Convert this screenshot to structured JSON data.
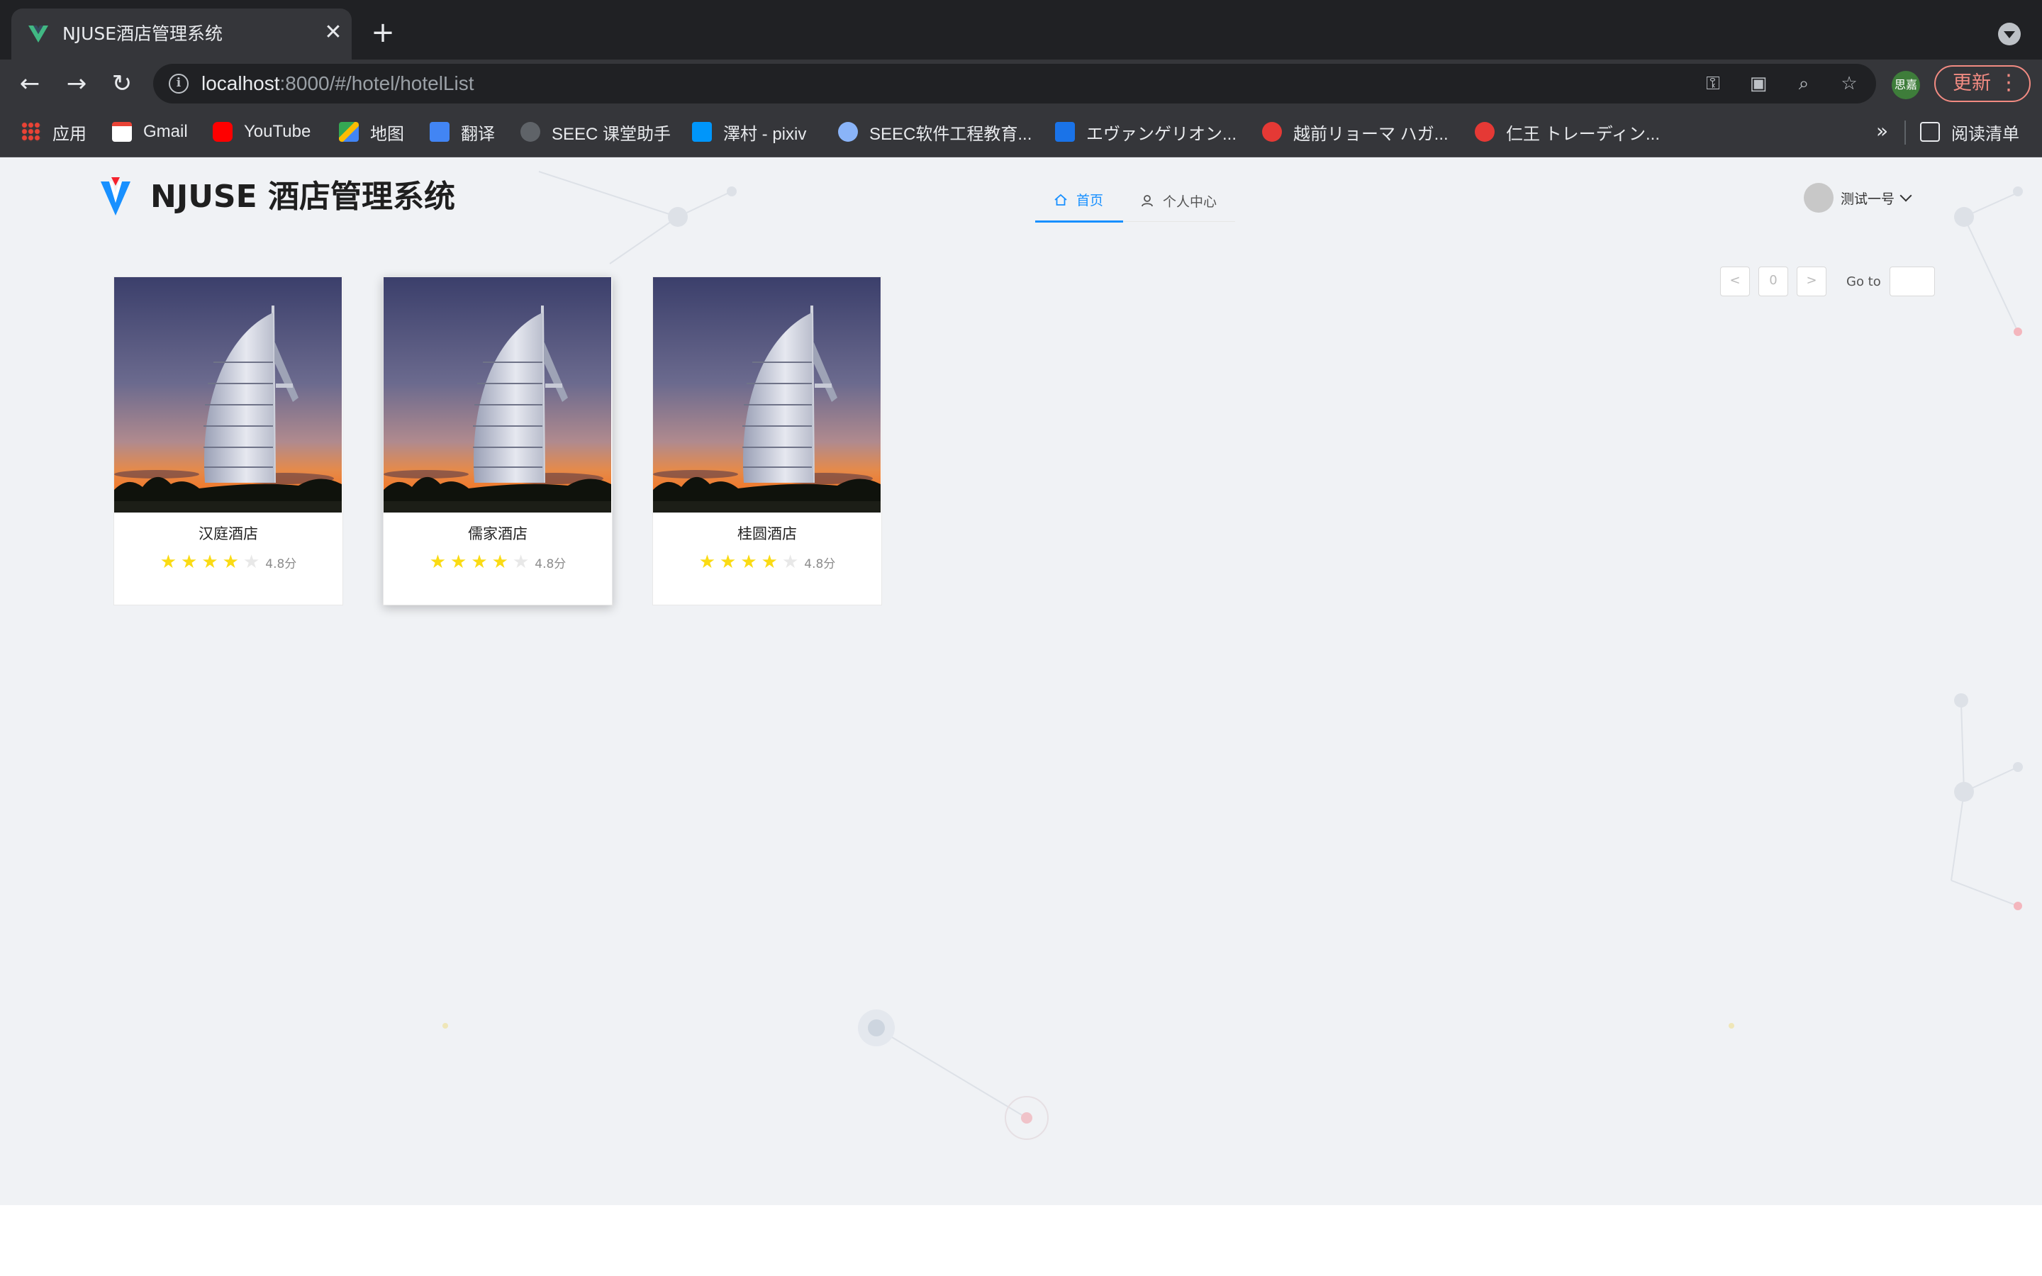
{
  "browser": {
    "tab_title": "NJUSE酒店管理系统",
    "url_host": "localhost",
    "url_rest": ":8000/#/hotel/hotelList",
    "profile_label": "思嘉",
    "update_label": "更新",
    "bookmarks": [
      {
        "label": "应用",
        "icon": "apps-grid-icon",
        "color": "#4285f4"
      },
      {
        "label": "Gmail",
        "icon": "gmail-icon",
        "color": "#ea4335"
      },
      {
        "label": "YouTube",
        "icon": "youtube-icon",
        "color": "#ff0000"
      },
      {
        "label": "地图",
        "icon": "maps-icon",
        "color": "#34a853"
      },
      {
        "label": "翻译",
        "icon": "translate-icon",
        "color": "#4285f4"
      },
      {
        "label": "SEEC 课堂助手",
        "icon": "cloud-icon",
        "color": "#5f6368"
      },
      {
        "label": "澤村 - pixiv",
        "icon": "pixiv-icon",
        "color": "#0096fa"
      },
      {
        "label": "SEEC软件工程教育...",
        "icon": "cloud-icon",
        "color": "#8ab4f8"
      },
      {
        "label": "エヴァンゲリオン...",
        "icon": "blue-doc-icon",
        "color": "#1a73e8"
      },
      {
        "label": "越前リョーマ ハガ...",
        "icon": "red-app-icon",
        "color": "#e53935"
      },
      {
        "label": "仁王 トレーディン...",
        "icon": "red-app-icon",
        "color": "#e53935"
      }
    ],
    "reading_list_label": "阅读清单"
  },
  "app": {
    "brand": "NJUSE 酒店管理系统",
    "menu": [
      {
        "label": "首页",
        "icon": "home-icon",
        "active": true
      },
      {
        "label": "个人中心",
        "icon": "user-icon",
        "active": false
      }
    ],
    "user_name": "测试一号",
    "pagination": {
      "current": "0",
      "goto_label": "Go to"
    },
    "hotels": [
      {
        "name": "汉庭酒店",
        "rating_stars": 4,
        "max_stars": 5,
        "score": "4.8分"
      },
      {
        "name": "儒家酒店",
        "rating_stars": 4,
        "max_stars": 5,
        "score": "4.8分"
      },
      {
        "name": "桂圆酒店",
        "rating_stars": 4,
        "max_stars": 5,
        "score": "4.8分"
      }
    ]
  },
  "colors": {
    "accent": "#1890ff",
    "star_on": "#fadb14",
    "star_off": "#e8e8e8",
    "page_bg": "#f0f2f5"
  }
}
